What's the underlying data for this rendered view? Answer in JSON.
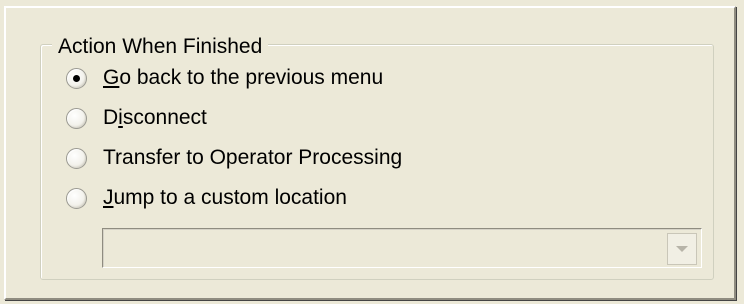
{
  "group": {
    "title": "Action When Finished"
  },
  "options": [
    {
      "prefix": "",
      "ul": "G",
      "suffix": "o back to the previous menu",
      "checked": true
    },
    {
      "prefix": "D",
      "ul": "i",
      "suffix": "sconnect",
      "checked": false
    },
    {
      "prefix": "Transfer to Operator Processing",
      "ul": "",
      "suffix": "",
      "checked": false
    },
    {
      "prefix": "",
      "ul": "J",
      "suffix": "ump to a custom location",
      "checked": false
    }
  ],
  "custom_location": {
    "value": "",
    "disabled": true
  },
  "icons": {
    "dropdown": "chevron-down-icon"
  }
}
